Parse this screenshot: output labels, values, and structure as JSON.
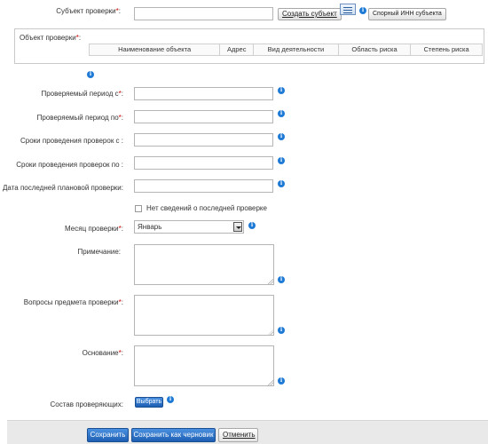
{
  "subject": {
    "label": "Субъект проверки",
    "required_mark": "*",
    "suffix": ":",
    "value": "",
    "create_button": "Создать субъект",
    "disputed_inn_button": "Спорный ИНН субъекта"
  },
  "object": {
    "label": "Объект проверки",
    "required_mark": "*",
    "suffix": ":",
    "columns": [
      "Наименование объекта",
      "Адрес",
      "Вид деятельности",
      "Область риска",
      "Степень риска"
    ]
  },
  "fields": {
    "period_from": {
      "label": "Проверяемый период с",
      "required_mark": "*",
      "suffix": ":",
      "value": ""
    },
    "period_to": {
      "label": "Проверяемый период по",
      "required_mark": "*",
      "suffix": ":",
      "value": ""
    },
    "terms_from": {
      "label": "Сроки проведения проверок с :",
      "value": ""
    },
    "terms_to": {
      "label": "Сроки проведения проверок по :",
      "value": ""
    },
    "last_planned": {
      "label": "Дата последней плановой проверки:",
      "value": ""
    },
    "no_info_checkbox": {
      "label": "Нет сведений о последней проверке",
      "checked": false
    },
    "month": {
      "label": "Месяц проверки",
      "required_mark": "*",
      "suffix": ":",
      "selected": "Январь"
    },
    "note": {
      "label": "Примечание:",
      "value": ""
    },
    "questions": {
      "label": "Вопросы предмета проверки",
      "required_mark": "*",
      "suffix": ":",
      "value": ""
    },
    "basis": {
      "label": "Основание",
      "required_mark": "*",
      "suffix": ":",
      "value": ""
    },
    "inspectors": {
      "label": "Состав проверяющих:",
      "button": "Выбрать"
    }
  },
  "footer": {
    "save": "Сохранить",
    "save_draft": "Сохранить как черновик",
    "cancel": "Отменить"
  },
  "icons": {
    "info": "info-icon",
    "list": "list-icon"
  },
  "colors": {
    "required": "#d00000",
    "info_icon": "#1f7ad6",
    "primary_button": "#2a6cc4"
  }
}
